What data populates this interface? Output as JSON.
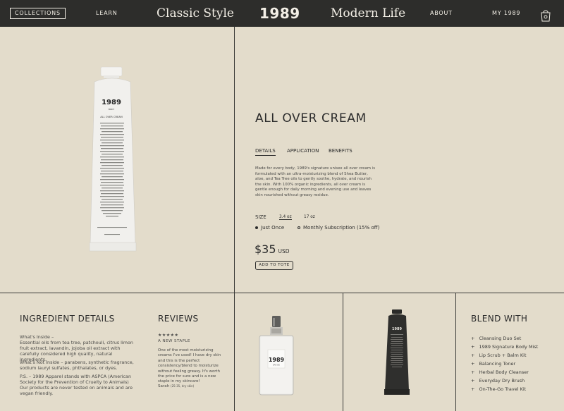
{
  "nav": {
    "collections": "COLLECTIONS",
    "learn": "LEARN",
    "classic": "Classic Style",
    "logo": "1989",
    "modern": "Modern Life",
    "about": "ABOUT",
    "my": "MY 1989",
    "bag_icon": "shopping-bag-icon"
  },
  "tube": {
    "brand": "1989",
    "line": "BODY",
    "name": "ALL OVER CREAM"
  },
  "product": {
    "title": "ALL OVER CREAM",
    "tabs": [
      "DETAILS",
      "APPLICATION",
      "BENEFITS"
    ],
    "description": "Made for every body, 1989's signature unisex all over cream is formulated with an ultra-moisturizing blend of Shea Butter, aloe, and Tea Tree oils to gently soothe, hydrate, and nourish the skin. With 100% organic ingredients, all over cream is gentle enough for daily morning and evening use and leaves skin nourished without greasy residue.",
    "size_label": "SIZE",
    "sizes": [
      "3.4 oz",
      "17 oz"
    ],
    "purchase_options": [
      "Just Once",
      "Monthly Subscription (15% off)"
    ],
    "price": "$35",
    "currency": "USD",
    "add_button": "ADD TO TOTE"
  },
  "ingredients": {
    "title": "INGREDIENT DETAILS",
    "inside": "What's Inside –\nEssential oils from tea tree, patchouli, citrus limon fruit extract, lavandin, jojoba oil extract with carefully considered high quality, natural ingredients.",
    "not_inside": "What's Not Inside – parabens, synthetic fragrance, sodium lauryl sulfates, phthalates, or dyes.",
    "ps": "P.S. – 1989 Apparel stands with ASPCA (American Society for the Prevention of Cruelty to Animals) Our products are never tested on animals and are vegan friendly."
  },
  "reviews": {
    "title": "REVIEWS",
    "stars": "★★★★★",
    "headline": "A NEW STAPLE",
    "body": "One of the most moisturizing creams I've used! I have dry skin and this is the perfect consistency/blend to moisturize without feeling greasy. It's worth the price for sure and is a new staple in my skincare!",
    "author": "Sarah",
    "author_meta": "(25-35, dry skin)"
  },
  "perfume": {
    "brand": "1989",
    "sub": "EAU DE"
  },
  "dark_tube": {
    "brand": "1989"
  },
  "blend": {
    "title": "BLEND WITH",
    "items": [
      "Cleansing Duo Set",
      "1989 Signature Body Mist",
      "Lip Scrub + Balm Kit",
      "Balancing Toner",
      "Herbal Body Cleanser",
      "Everyday Dry Brush",
      "On-The-Go Travel Kit"
    ]
  },
  "colors": {
    "background": "#e3dccb",
    "nav": "#2d2d2b",
    "text": "#2c2c2c"
  }
}
